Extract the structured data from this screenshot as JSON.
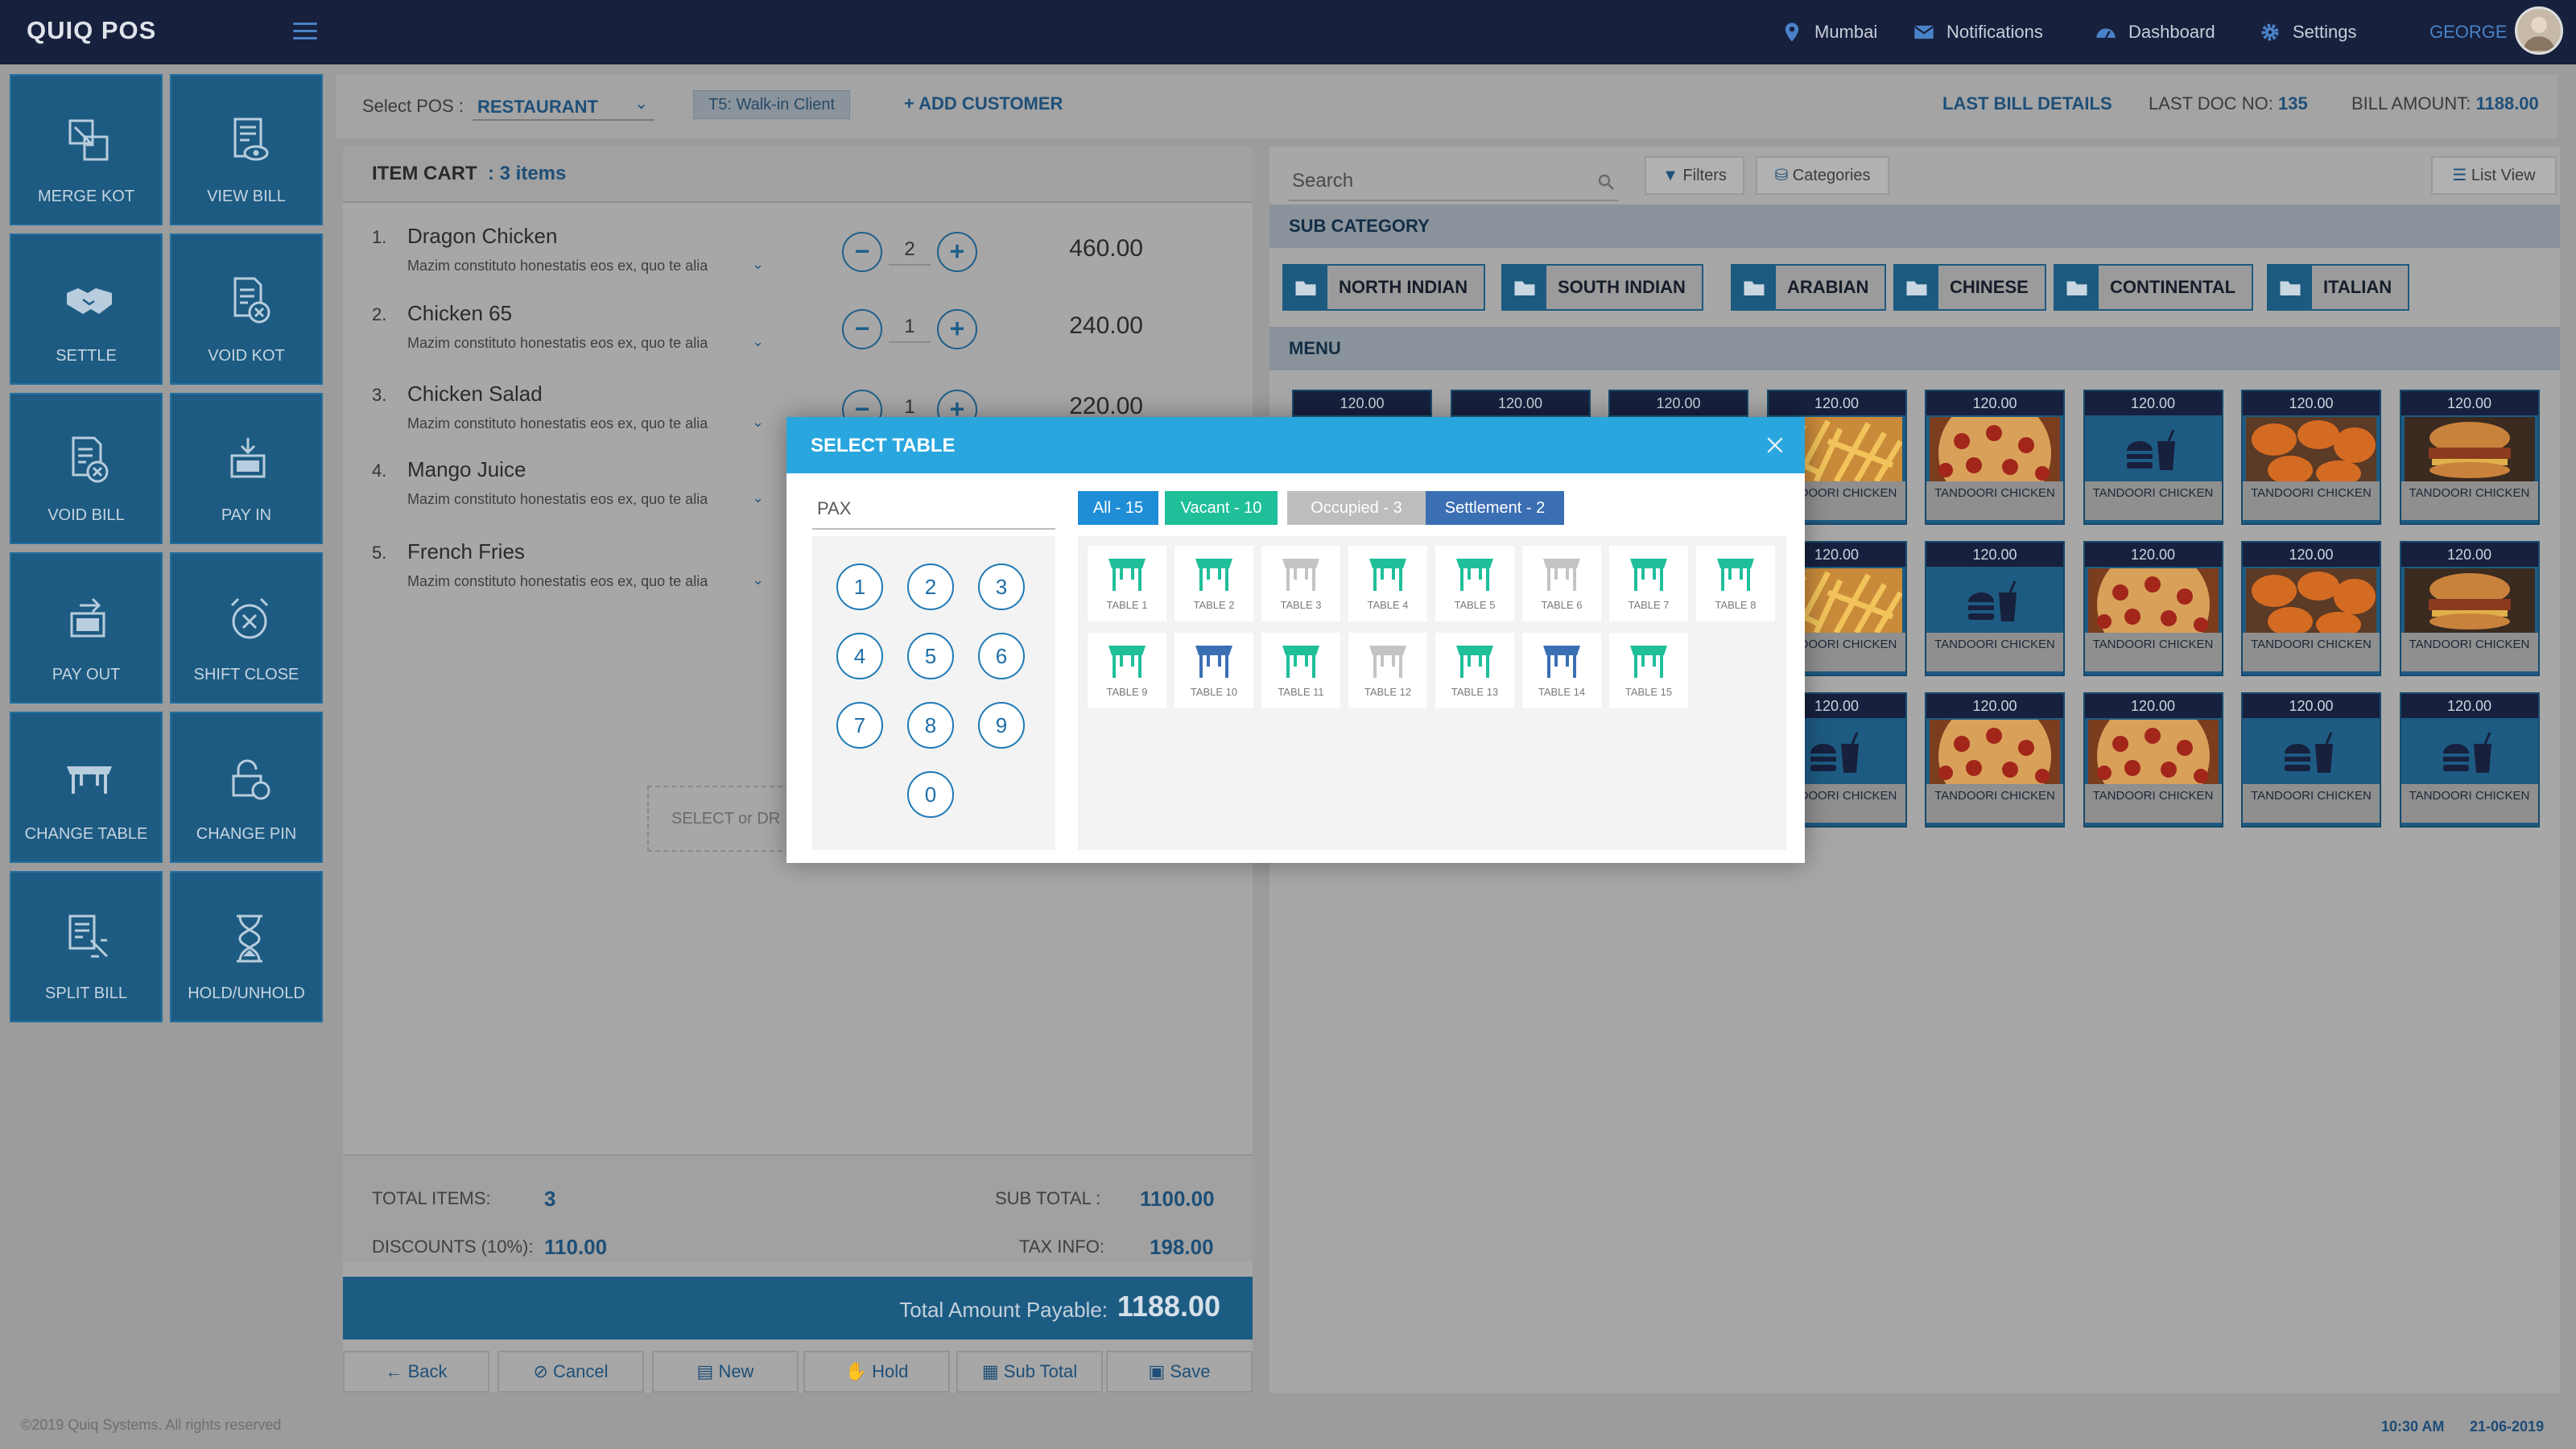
{
  "app": {
    "brand": "QUIQ POS"
  },
  "nav": {
    "location": "Mumbai",
    "notifications": "Notifications",
    "dashboard": "Dashboard",
    "settings": "Settings",
    "user": "GEORGE"
  },
  "actions": [
    {
      "label": "MERGE KOT",
      "icon": "merge-kot-icon"
    },
    {
      "label": "VIEW BILL",
      "icon": "view-bill-icon"
    },
    {
      "label": "SETTLE",
      "icon": "handshake-icon"
    },
    {
      "label": "VOID KOT",
      "icon": "void-kot-icon"
    },
    {
      "label": "VOID BILL",
      "icon": "void-bill-icon"
    },
    {
      "label": "PAY IN",
      "icon": "pay-in-icon"
    },
    {
      "label": "PAY OUT",
      "icon": "pay-out-icon"
    },
    {
      "label": "SHIFT CLOSE",
      "icon": "alarm-clock-icon"
    },
    {
      "label": "CHANGE TABLE",
      "icon": "table-icon"
    },
    {
      "label": "CHANGE PIN",
      "icon": "lock-icon"
    },
    {
      "label": "SPLIT BILL",
      "icon": "split-bill-icon"
    },
    {
      "label": "HOLD/UNHOLD",
      "icon": "hourglass-icon"
    }
  ],
  "posbar": {
    "select_label": "Select POS :",
    "select_value": "RESTAURANT",
    "table_chip": "T5: Walk-in Client",
    "add_customer": "ADD CUSTOMER",
    "last_bill_details": "LAST BILL DETAILS",
    "last_doc_label": "LAST DOC NO:",
    "last_doc_value": "135",
    "bill_amount_label": "BILL AMOUNT:",
    "bill_amount_value": "1188.00"
  },
  "cart": {
    "title": "ITEM CART",
    "count": ": 3 items",
    "items": [
      {
        "num": "1.",
        "name": "Dragon Chicken",
        "desc": "Mazim constituto honestatis eos ex, quo te alia",
        "qty": "2",
        "price": "460.00"
      },
      {
        "num": "2.",
        "name": "Chicken 65",
        "desc": "Mazim constituto honestatis eos ex, quo te alia",
        "qty": "1",
        "price": "240.00"
      },
      {
        "num": "3.",
        "name": "Chicken Salad",
        "desc": "Mazim constituto honestatis eos ex, quo te alia",
        "qty": "1",
        "price": "220.00"
      },
      {
        "num": "4.",
        "name": "Mango Juice",
        "desc": "Mazim constituto honestatis eos ex, quo te alia"
      },
      {
        "num": "5.",
        "name": "French Fries",
        "desc": "Mazim constituto honestatis eos ex, quo te alia"
      }
    ],
    "dropzone": "SELECT or DR",
    "totals": {
      "total_items_label": "TOTAL ITEMS:",
      "total_items": "3",
      "discounts_label": "DISCOUNTS (10%):",
      "discounts": "110.00",
      "subtotal_label": "SUB TOTAL :",
      "subtotal": "1100.00",
      "tax_label": "TAX INFO:",
      "tax": "198.00"
    },
    "payable_label": "Total Amount Payable:",
    "payable_value": "1188.00",
    "buttons": {
      "back": "Back",
      "cancel": "Cancel",
      "new": "New",
      "hold": "Hold",
      "subtotal": "Sub Total",
      "save": "Save"
    }
  },
  "menu": {
    "search_placeholder": "Search",
    "filters": "Filters",
    "categories": "Categories",
    "list_view": "List View",
    "subcategory_title": "SUB CATEGORY",
    "subcategories": [
      "NORTH INDIAN",
      "SOUTH INDIAN",
      "ARABIAN",
      "CHINESE",
      "CONTINENTAL",
      "ITALIAN"
    ],
    "menu_title": "MENU",
    "item_name": "TANDOORI CHICKEN",
    "item_price": "120.00",
    "item_kinds": [
      "",
      "",
      "",
      "fries",
      "pizza",
      "icon",
      "wings",
      "burger",
      "",
      "",
      "",
      "fries",
      "icon",
      "pizza",
      "wings",
      "burger",
      "",
      "",
      "",
      "icon",
      "pizza",
      "pizza",
      "icon",
      "icon"
    ]
  },
  "modal": {
    "title": "SELECT TABLE",
    "pax_placeholder": "PAX",
    "keys": [
      "1",
      "2",
      "3",
      "4",
      "5",
      "6",
      "7",
      "8",
      "9",
      "0"
    ],
    "filters": [
      {
        "label": "All - 15",
        "color": "#1f8ed6"
      },
      {
        "label": "Vacant - 10",
        "color": "#1fbf9a"
      },
      {
        "label": "Occupied - 3",
        "color": "#bdbdbd"
      },
      {
        "label": "Settlement - 2",
        "color": "#3b6fb4"
      }
    ],
    "status_colors": {
      "vacant": "#1fbf9a",
      "occupied": "#c4c4c4",
      "settlement": "#3b6fb4"
    },
    "tables": [
      {
        "label": "TABLE 1",
        "status": "vacant"
      },
      {
        "label": "TABLE 2",
        "status": "vacant"
      },
      {
        "label": "TABLE 3",
        "status": "occupied"
      },
      {
        "label": "TABLE 4",
        "status": "vacant"
      },
      {
        "label": "TABLE 5",
        "status": "vacant"
      },
      {
        "label": "TABLE 6",
        "status": "occupied"
      },
      {
        "label": "TABLE 7",
        "status": "vacant"
      },
      {
        "label": "TABLE 8",
        "status": "vacant"
      },
      {
        "label": "TABLE 9",
        "status": "vacant"
      },
      {
        "label": "TABLE 10",
        "status": "settlement"
      },
      {
        "label": "TABLE 11",
        "status": "vacant"
      },
      {
        "label": "TABLE 12",
        "status": "occupied"
      },
      {
        "label": "TABLE 13",
        "status": "vacant"
      },
      {
        "label": "TABLE 14",
        "status": "settlement"
      },
      {
        "label": "TABLE 15",
        "status": "vacant"
      }
    ]
  },
  "footer": {
    "copyright": "©2019 Quiq Systems. All rights reserved",
    "time": "10:30 AM",
    "date": "21-06-2019"
  }
}
